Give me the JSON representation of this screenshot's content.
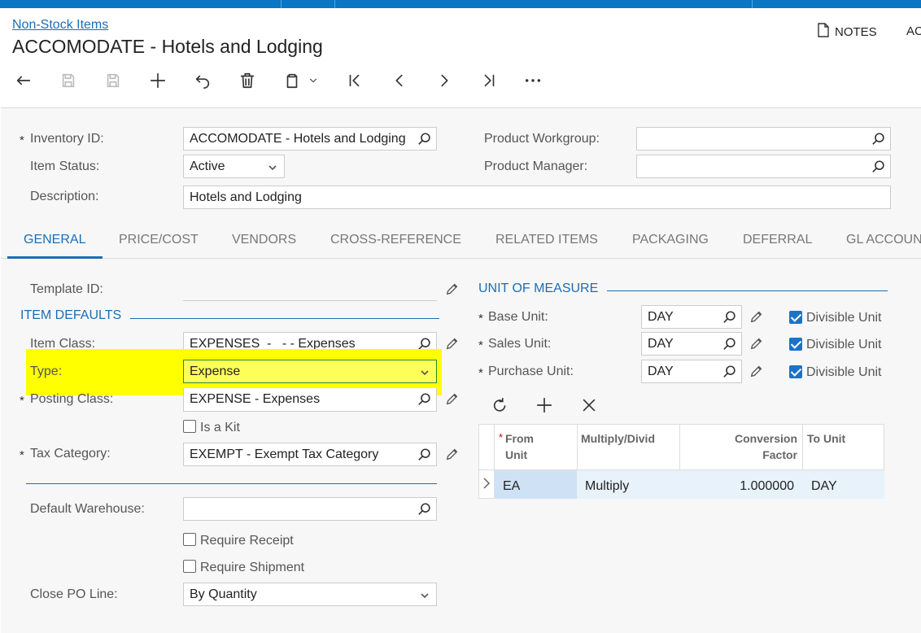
{
  "breadcrumb": "Non-Stock Items",
  "title": "ACCOMODATE - Hotels and Lodging",
  "header_buttons": {
    "notes": "NOTES",
    "ac": "AC"
  },
  "toolbar": [
    "back",
    "save-close",
    "save",
    "add",
    "undo",
    "delete",
    "copy-paste",
    "first",
    "previous",
    "next",
    "last",
    "more"
  ],
  "form": {
    "inventory_id": {
      "label": "Inventory ID:",
      "value": "ACCOMODATE - Hotels and Lodging"
    },
    "item_status": {
      "label": "Item Status:",
      "value": "Active"
    },
    "description": {
      "label": "Description:",
      "value": "Hotels and Lodging"
    },
    "product_workgroup": {
      "label": "Product Workgroup:",
      "value": ""
    },
    "product_manager": {
      "label": "Product Manager:",
      "value": ""
    }
  },
  "tabs": [
    "GENERAL",
    "PRICE/COST",
    "VENDORS",
    "CROSS-REFERENCE",
    "RELATED ITEMS",
    "PACKAGING",
    "DEFERRAL",
    "GL ACCOUN"
  ],
  "general": {
    "template_id": {
      "label": "Template ID:",
      "value": ""
    },
    "item_defaults_title": "ITEM DEFAULTS",
    "item_class": {
      "label": "Item Class:",
      "value": "EXPENSES  -   - - Expenses"
    },
    "type": {
      "label": "Type:",
      "value": "Expense"
    },
    "posting_class": {
      "label": "Posting Class:",
      "value": "EXPENSE - Expenses"
    },
    "is_kit": {
      "label": "Is a Kit",
      "checked": false
    },
    "tax_category": {
      "label": "Tax Category:",
      "value": "EXEMPT - Exempt Tax Category"
    },
    "default_warehouse": {
      "label": "Default Warehouse:",
      "value": ""
    },
    "require_receipt": {
      "label": "Require Receipt",
      "checked": false
    },
    "require_shipment": {
      "label": "Require Shipment",
      "checked": false
    },
    "close_po_line": {
      "label": "Close PO Line:",
      "value": "By Quantity"
    }
  },
  "uom": {
    "title": "UNIT OF MEASURE",
    "base_unit": {
      "label": "Base Unit:",
      "value": "DAY",
      "divisible_label": "Divisible Unit",
      "divisible": true
    },
    "sales_unit": {
      "label": "Sales Unit:",
      "value": "DAY",
      "divisible_label": "Divisible Unit",
      "divisible": true
    },
    "purchase_unit": {
      "label": "Purchase Unit:",
      "value": "DAY",
      "divisible_label": "Divisible Unit",
      "divisible": true
    },
    "grid": {
      "headers": {
        "from_unit_1": "From",
        "from_unit_2": "Unit",
        "multiply": "Multiply/Divid",
        "conv_1": "Conversion",
        "conv_2": "Factor",
        "to_unit": "To Unit"
      },
      "rows": [
        {
          "from_unit": "EA",
          "multiply": "Multiply",
          "factor": "1.000000",
          "to_unit": "DAY"
        }
      ]
    }
  },
  "colors": {
    "accent": "#1a6eb5",
    "topbar": "#0a76c4",
    "highlight": "#ffff00"
  }
}
